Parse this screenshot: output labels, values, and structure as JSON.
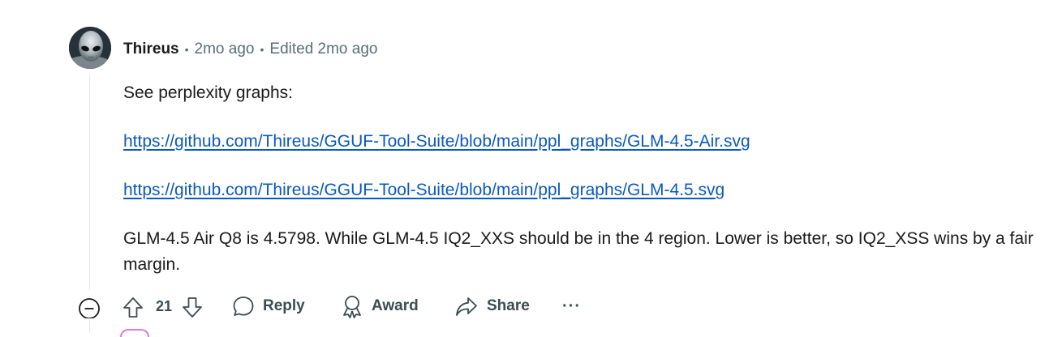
{
  "comment": {
    "author": "Thireus",
    "time": "2mo ago",
    "edited": "Edited 2mo ago",
    "body": {
      "intro": "See perplexity graphs:",
      "links": [
        "https://github.com/Thireus/GGUF-Tool-Suite/blob/main/ppl_graphs/GLM-4.5-Air.svg",
        "https://github.com/Thireus/GGUF-Tool-Suite/blob/main/ppl_graphs/GLM-4.5.svg"
      ],
      "conclusion": "GLM-4.5 Air Q8 is 4.5798. While GLM-4.5 IQ2_XXS should be in the 4 region. Lower is better, so IQ2_XSS wins by a fair margin."
    },
    "actions": {
      "vote_count": "21",
      "reply_label": "Reply",
      "award_label": "Award",
      "share_label": "Share",
      "more_label": "···"
    },
    "icons": {
      "collapse": "minus-circle-icon",
      "upvote": "arrow-up-icon",
      "downvote": "arrow-down-icon",
      "reply": "speech-bubble-icon",
      "award": "award-ribbon-icon",
      "share": "share-arrow-icon",
      "more": "ellipsis-icon"
    },
    "colors": {
      "link": "#0b59bf",
      "meta": "#576f76",
      "text": "#1a1a1b"
    }
  }
}
